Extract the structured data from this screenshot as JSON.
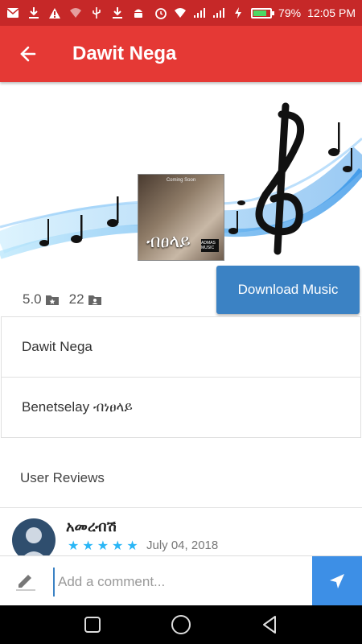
{
  "status_bar": {
    "battery": "79%",
    "time": "12:05 PM",
    "battery_level": 0.79
  },
  "app_bar": {
    "title": "Dawit Nega",
    "background": "#e53935"
  },
  "album": {
    "cover_title": "ብፀላይ",
    "cover_top_text": "Coming Soon",
    "cover_logo_text": "ADMAS MUSIC"
  },
  "stats": {
    "rating": "5.0",
    "count": "22"
  },
  "download_button": {
    "label": "Download Music",
    "color": "#3b82c4"
  },
  "info": {
    "artist": "Dawit Nega",
    "song": "Benetselay ብነፀላይ"
  },
  "reviews": {
    "heading": "User Reviews",
    "items": [
      {
        "name": "አመረብሽ",
        "stars": 5,
        "date": "July 04, 2018"
      }
    ]
  },
  "comment": {
    "placeholder": "Add a comment..."
  },
  "icons": {
    "star_color": "#29b6f6",
    "send_color": "#3d8fe6"
  }
}
